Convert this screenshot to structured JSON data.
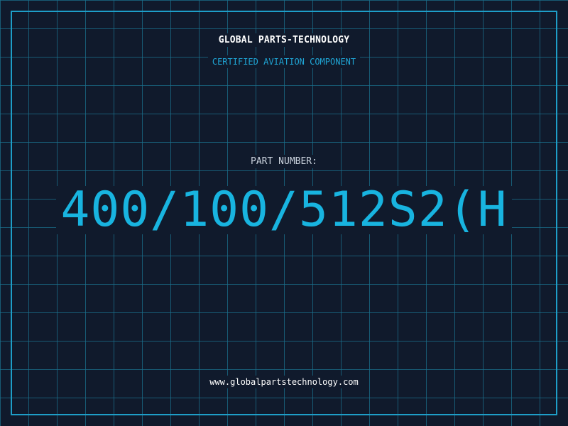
{
  "header": {
    "company": "GLOBAL PARTS-TECHNOLOGY",
    "subtitle": "CERTIFIED AVIATION COMPONENT"
  },
  "part": {
    "label": "PART NUMBER:",
    "number": "400/100/512S2(H"
  },
  "footer": {
    "website": "www.globalpartstechnology.com"
  },
  "colors": {
    "background": "#101a2c",
    "grid": "#1a6f8c",
    "frame": "#1e9ec8",
    "accent": "#18b4e0",
    "subtitle": "#1fa6d6"
  }
}
